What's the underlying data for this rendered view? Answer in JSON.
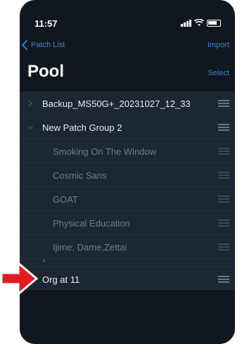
{
  "status": {
    "time": "11:57"
  },
  "nav": {
    "back_label": "Patch List",
    "import_label": "Import"
  },
  "header": {
    "title": "Pool",
    "select_label": "Select"
  },
  "list": {
    "groups": [
      {
        "label": "Backup_MS50G+_20231027_12_33",
        "expanded": false
      },
      {
        "label": "New Patch Group 2",
        "expanded": true,
        "children": [
          "Smoking On The Window",
          "Cosmic Sans",
          "GOAT",
          "Physical Education",
          "Ijime, Dame,Zettai"
        ]
      }
    ],
    "dragging_item": "Org at 11"
  },
  "colors": {
    "accent": "#3f82d8",
    "background": "#11171e",
    "row": "#1d2731",
    "arrow": "#e21b22"
  }
}
